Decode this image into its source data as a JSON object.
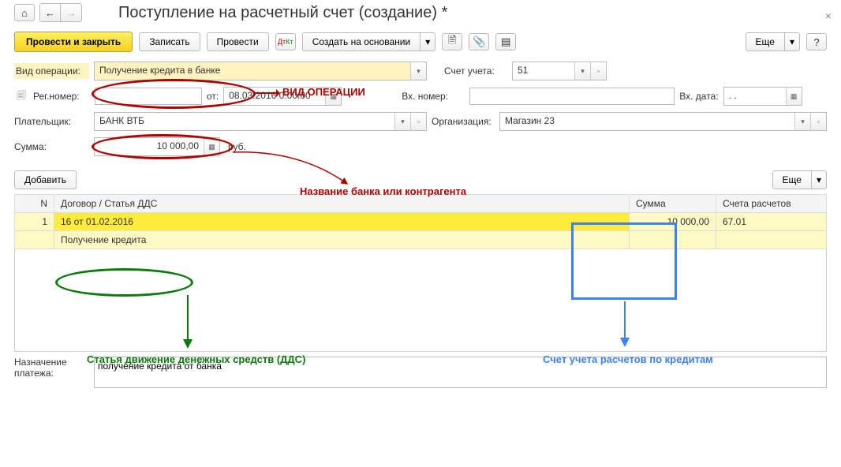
{
  "title": "Поступление на расчетный счет (создание) *",
  "toolbar": {
    "post_close": "Провести и закрыть",
    "write": "Записать",
    "post": "Провести",
    "create_based": "Создать на основании",
    "more": "Еще"
  },
  "labels": {
    "op_type": "Вид операции:",
    "account": "Счет учета:",
    "reg_num": "Рег.номер:",
    "from": "от:",
    "in_num": "Вх. номер:",
    "in_date": "Вх. дата:",
    "payer": "Плательщик:",
    "org": "Организация:",
    "sum": "Сумма:",
    "currency": "руб.",
    "add": "Добавить",
    "purpose": "Назначение\nплатежа:"
  },
  "fields": {
    "op_type_val": "Получение кредита в банке",
    "account_val": "51",
    "reg_num_val": "",
    "date_val": "08.03.2016  0:00:00",
    "in_num_val": "",
    "in_date_val": ". .",
    "payer_val": "БАНК ВТБ",
    "org_val": "Магазин 23",
    "sum_val": "10 000,00",
    "purpose_val": "получение кредита от банка"
  },
  "table": {
    "headers": {
      "n": "N",
      "contract": "Договор / Статья ДДС",
      "sum": "Сумма",
      "accounts": "Счета расчетов"
    },
    "row1": {
      "n": "1",
      "contract": "16 от 01.02.2016",
      "sum": "10 000,00",
      "acct": "67.01"
    },
    "row2": {
      "contract": "Получение кредита"
    }
  },
  "annotations": {
    "op_type": "ВИД ОПЕРАЦИИ",
    "bank_name": "Название банка или контрагента",
    "dds": "Статья движение денежных средств (ДДС)",
    "acct": "Счет учета расчетов по кредитам"
  }
}
